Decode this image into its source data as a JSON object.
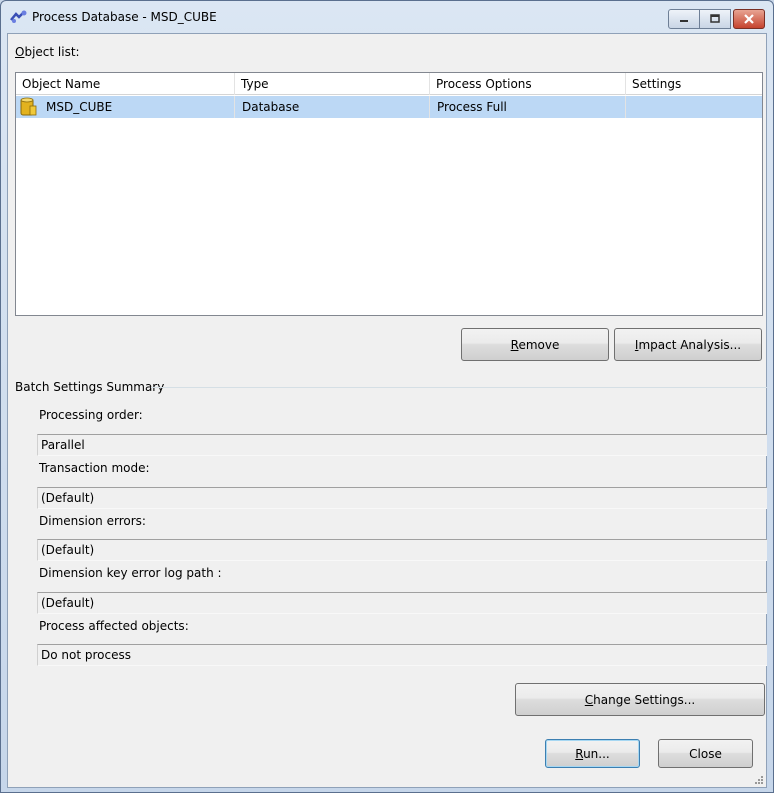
{
  "window": {
    "title": "Process Database - MSD_CUBE",
    "minimize_icon": "minimize-icon",
    "maximize_icon": "restore-icon",
    "close_icon": "close-icon"
  },
  "object_list": {
    "label_underlined": "O",
    "label_rest": "bject list:",
    "columns": [
      "Object Name",
      "Type",
      "Process Options",
      "Settings"
    ],
    "rows": [
      {
        "icon": "database-icon",
        "name": "MSD_CUBE",
        "type": "Database",
        "process_options": "Process Full",
        "settings": ""
      }
    ],
    "selected_row_color": "#bcd8f5"
  },
  "buttons": {
    "remove_underlined": "R",
    "remove_rest": "emove",
    "impact_underlined": "I",
    "impact_rest": "mpact Analysis...",
    "change_underlined": "C",
    "change_rest": "hange Settings...",
    "run_underlined": "R",
    "run_rest": "un...",
    "close": "Close"
  },
  "batch": {
    "title": "Batch Settings Summary",
    "settings": [
      {
        "label": "Processing order:",
        "value": "Parallel"
      },
      {
        "label": "Transaction mode:",
        "value": "(Default)"
      },
      {
        "label": "Dimension errors:",
        "value": "(Default)"
      },
      {
        "label": "Dimension key error log path :",
        "value": "(Default)"
      },
      {
        "label": "Process affected objects:",
        "value": "Do not process"
      }
    ]
  }
}
